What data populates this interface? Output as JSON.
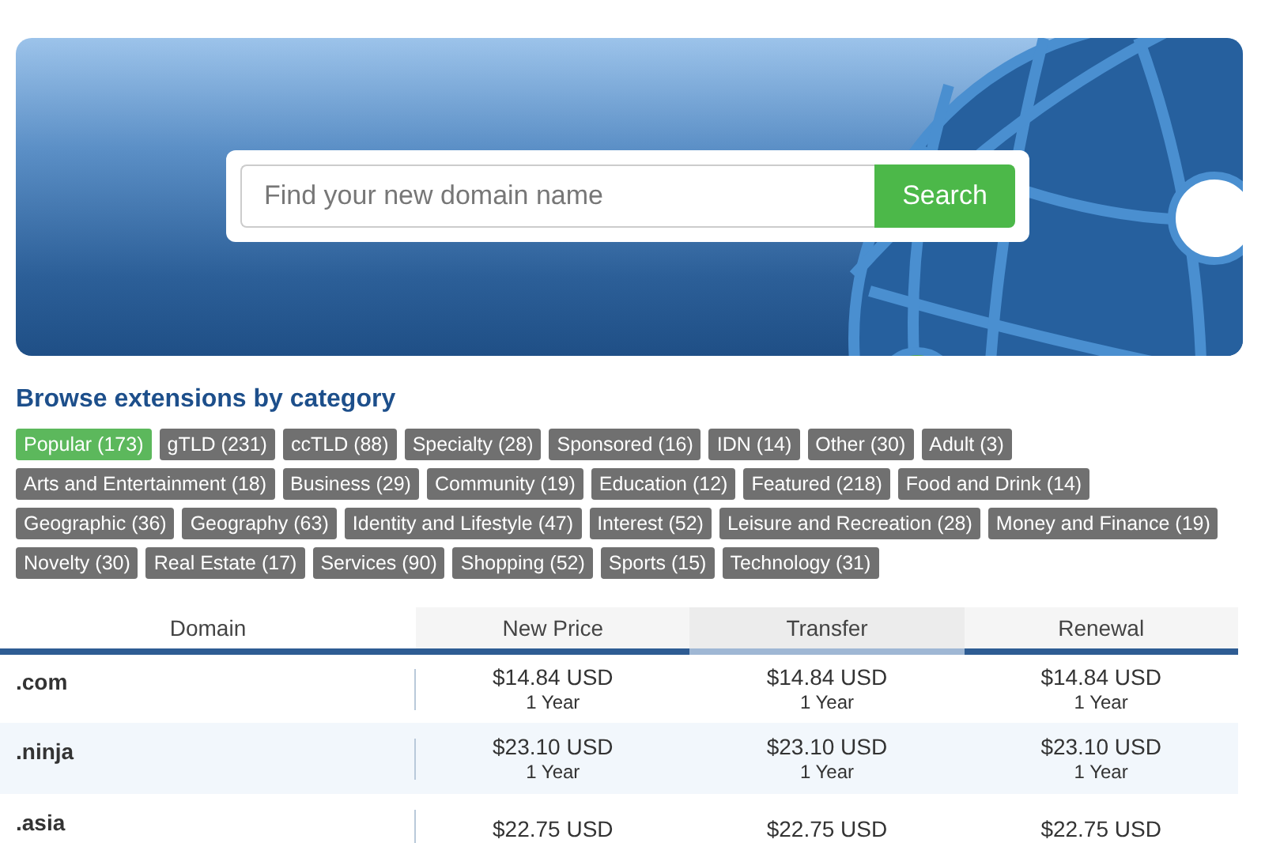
{
  "hero": {
    "search": {
      "placeholder": "Find your new domain name",
      "button": "Search"
    }
  },
  "categories": {
    "title": "Browse extensions by category",
    "rows": [
      [
        {
          "label": "Popular (173)",
          "selected": true
        },
        {
          "label": "gTLD (231)",
          "selected": false
        },
        {
          "label": "ccTLD (88)",
          "selected": false
        },
        {
          "label": "Specialty (28)",
          "selected": false
        },
        {
          "label": "Sponsored (16)",
          "selected": false
        },
        {
          "label": "IDN (14)",
          "selected": false
        },
        {
          "label": "Other (30)",
          "selected": false
        },
        {
          "label": "Adult (3)",
          "selected": false
        }
      ],
      [
        {
          "label": "Arts and Entertainment (18)",
          "selected": false
        },
        {
          "label": "Business (29)",
          "selected": false
        },
        {
          "label": "Community (19)",
          "selected": false
        },
        {
          "label": "Education (12)",
          "selected": false
        },
        {
          "label": "Featured (218)",
          "selected": false
        },
        {
          "label": "Food and Drink (14)",
          "selected": false
        }
      ],
      [
        {
          "label": "Geographic (36)",
          "selected": false
        },
        {
          "label": "Geography (63)",
          "selected": false
        },
        {
          "label": "Identity and Lifestyle (47)",
          "selected": false
        },
        {
          "label": "Interest (52)",
          "selected": false
        },
        {
          "label": "Leisure and Recreation (28)",
          "selected": false
        },
        {
          "label": "Money and Finance (19)",
          "selected": false
        }
      ],
      [
        {
          "label": "Novelty (30)",
          "selected": false
        },
        {
          "label": "Real Estate (17)",
          "selected": false
        },
        {
          "label": "Services (90)",
          "selected": false
        },
        {
          "label": "Shopping (52)",
          "selected": false
        },
        {
          "label": "Sports (15)",
          "selected": false
        },
        {
          "label": "Technology (31)",
          "selected": false
        }
      ]
    ]
  },
  "table": {
    "columns": [
      {
        "label": "Domain",
        "selected": false
      },
      {
        "label": "New Price",
        "selected": false
      },
      {
        "label": "Transfer",
        "selected": true
      },
      {
        "label": "Renewal",
        "selected": false
      }
    ],
    "rows": [
      {
        "domain": ".com",
        "prices": [
          {
            "price": "$14.84 USD",
            "term": "1 Year"
          },
          {
            "price": "$14.84 USD",
            "term": "1 Year"
          },
          {
            "price": "$14.84 USD",
            "term": "1 Year"
          }
        ]
      },
      {
        "domain": ".ninja",
        "prices": [
          {
            "price": "$23.10 USD",
            "term": "1 Year"
          },
          {
            "price": "$23.10 USD",
            "term": "1 Year"
          },
          {
            "price": "$23.10 USD",
            "term": "1 Year"
          }
        ]
      },
      {
        "domain": ".asia",
        "prices": [
          {
            "price": "$22.75 USD"
          },
          {
            "price": "$22.75 USD"
          },
          {
            "price": "$22.75 USD"
          }
        ]
      }
    ]
  }
}
